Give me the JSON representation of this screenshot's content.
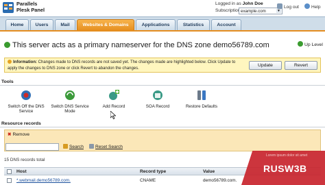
{
  "brand": {
    "line1": "Parallels",
    "line2": "Plesk Panel"
  },
  "header": {
    "logged_prefix": "Logged in as",
    "user": "John Doe",
    "subscription_label": "Subscription",
    "subscription_value": "example.com",
    "logout": "Log out",
    "help": "Help"
  },
  "tabs": [
    "Home",
    "Users",
    "Mail",
    "Websites & Domains",
    "Applications",
    "Statistics",
    "Account"
  ],
  "page": {
    "title": "This server acts as a primary nameserver for the DNS zone demo56789.com",
    "up_level": "Up Level"
  },
  "info": {
    "label": "Information:",
    "text": "Changes made to DNS records are not saved yet. The changes made are highlighted below. Click Update to apply the changes to DNS zone or click Revert to abandon the changes.",
    "update": "Update",
    "revert": "Revert"
  },
  "tools": {
    "title": "Tools",
    "items": [
      {
        "label": "Switch Off the DNS Service",
        "icon": "dns-switch-off-icon"
      },
      {
        "label": "Switch DNS Service Mode",
        "icon": "dns-mode-icon"
      },
      {
        "label": "Add Record",
        "icon": "add-record-icon"
      },
      {
        "label": "SOA Record",
        "icon": "soa-record-icon"
      },
      {
        "label": "Restore Defaults",
        "icon": "restore-defaults-icon"
      }
    ]
  },
  "resources": {
    "title": "Resource records",
    "remove": "Remove",
    "search_value": "",
    "search": "Search",
    "reset": "Reset Search",
    "total": "15 DNS records total",
    "columns": [
      "Host",
      "Record type",
      "Value"
    ],
    "rows": [
      {
        "host": "*.webmail.demo56789.com.",
        "type": "CNAME",
        "value": "demo56789.com."
      }
    ]
  },
  "watermark": {
    "text": "RUSW3B",
    "sub": "Lorem ipsum dolor sit amet"
  },
  "colors": {
    "accent": "#e58d1e",
    "info_bg": "#fff6bf",
    "tab_bg": "#cfdde9",
    "link": "#1a4f9c"
  }
}
